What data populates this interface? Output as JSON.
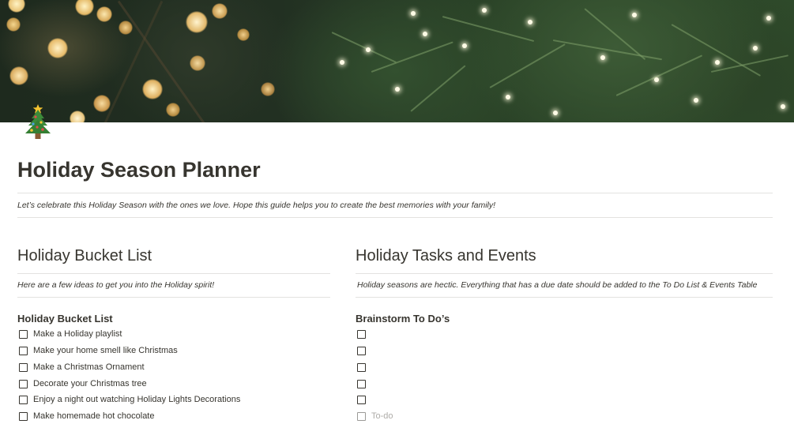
{
  "page": {
    "icon": "christmas-tree-icon",
    "title": "Holiday Season Planner",
    "intro": "Let’s celebrate this Holiday Season with the ones we love. Hope this guide helps you to create the best memories with your family!"
  },
  "left_column": {
    "heading": "Holiday Bucket List",
    "description": "Here are a few ideas to get you into the Holiday spirit!",
    "list_title": "Holiday Bucket List",
    "items": [
      {
        "label": "Make a Holiday playlist",
        "checked": false
      },
      {
        "label": "Make your home smell like Christmas",
        "checked": false
      },
      {
        "label": "Make a Christmas Ornament",
        "checked": false
      },
      {
        "label": "Decorate your Christmas tree",
        "checked": false
      },
      {
        "label": "Enjoy a night out watching Holiday Lights Decorations",
        "checked": false
      },
      {
        "label": "Make homemade hot chocolate",
        "checked": false
      }
    ]
  },
  "right_column": {
    "heading": "Holiday Tasks and Events",
    "description": "Holiday seasons are hectic. Everything that has a due date should be added to the To Do List & Events Table",
    "list_title": "Brainstorm To Do’s",
    "items": [
      {
        "label": "",
        "checked": false
      },
      {
        "label": "",
        "checked": false
      },
      {
        "label": "",
        "checked": false
      },
      {
        "label": "",
        "checked": false
      },
      {
        "label": "",
        "checked": false
      }
    ],
    "new_item_placeholder": "To-do"
  },
  "colors": {
    "text": "#37352f",
    "divider": "#e3e2e0",
    "placeholder": "#aeaca8",
    "cover_green": "#2e4a2a"
  }
}
